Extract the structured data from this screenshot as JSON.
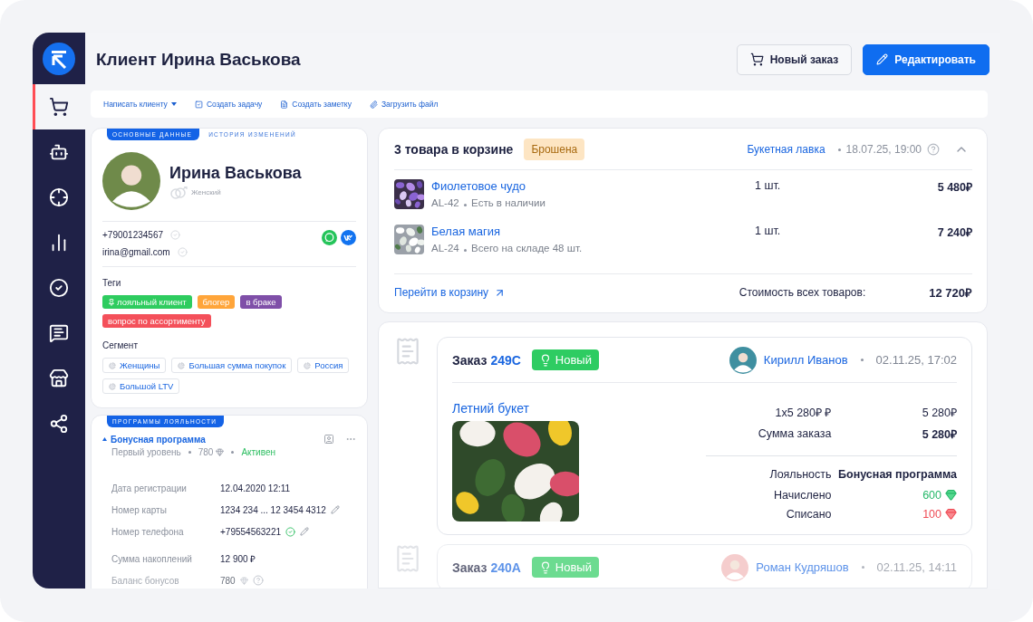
{
  "sidebar": {
    "items": [
      {
        "kind": "cart",
        "selected": true
      },
      {
        "kind": "bot",
        "selected": false
      },
      {
        "kind": "target",
        "selected": false
      },
      {
        "kind": "chart",
        "selected": false
      },
      {
        "kind": "tasks",
        "selected": false
      },
      {
        "kind": "chat",
        "selected": false
      },
      {
        "kind": "store",
        "selected": false
      },
      {
        "kind": "share",
        "selected": false
      }
    ]
  },
  "header": {
    "title": "Клиент Ирина Васькова",
    "buttons": [
      {
        "kind": "secondary",
        "label": "Новый заказ"
      },
      {
        "kind": "primary",
        "label": "Редактировать"
      }
    ]
  },
  "toolbar": [
    {
      "kind": "dropdown",
      "label": "Написать клиенту"
    },
    {
      "kind": "task",
      "label": "Создать задачу"
    },
    {
      "kind": "note",
      "label": "Создать заметку"
    },
    {
      "kind": "file",
      "label": "Загрузить файл"
    }
  ],
  "client": {
    "tabs": [
      {
        "label": "ОСНОВНЫЕ ДАННЫЕ",
        "selected": true
      },
      {
        "label": "ИСТОРИЯ ИЗМЕНЕНИЙ",
        "selected": false
      }
    ],
    "name": "Ирина Васькова",
    "gender": "Женский",
    "contacts": [
      {
        "value": "+79001234567",
        "verified": false
      },
      {
        "value": "irina@gmail.com",
        "verified": false
      }
    ],
    "messengers": [
      {
        "kind": "whatsapp"
      },
      {
        "kind": "vk"
      }
    ],
    "tags_label": "Теги",
    "tags": [
      {
        "label": "лояльный клиент",
        "color": "#2ecc5f",
        "pinned": true
      },
      {
        "label": "блогер",
        "color": "#ffa53a",
        "pinned": false
      },
      {
        "label": "в браке",
        "color": "#7f4fa8",
        "pinned": false
      },
      {
        "label": "вопрос по ассортименту",
        "color": "#f4505a",
        "pinned": false
      }
    ],
    "segments_label": "Сегмент",
    "segments": [
      "Женщины",
      "Большая сумма покупок",
      "Россия",
      "Большой LTV"
    ]
  },
  "loyalty": {
    "section": "ПРОГРАММЫ ЛОЯЛЬНОСТИ",
    "program": {
      "name": "Бонусная программа",
      "expanded": true,
      "level": "Первый уровень",
      "points": "780",
      "status": "Активен",
      "active": true
    },
    "fields": [
      {
        "label": "Дата регистрации",
        "value": "12.04.2020 12:11",
        "kind": "plain",
        "faded": false
      },
      {
        "label": "Номер карты",
        "value": "1234 234 ... 12 3454 4312",
        "kind": "editable",
        "faded": false
      },
      {
        "label": "Номер телефона",
        "value": "+79554563221",
        "kind": "phone",
        "verified": true,
        "faded": false
      },
      {
        "label": "Сумма накоплений",
        "value": "12 900 ₽",
        "kind": "plain",
        "faded": false
      },
      {
        "label": "Баланс бонусов",
        "value": "780",
        "kind": "bonus",
        "faded": true
      }
    ]
  },
  "cart": {
    "title": "3 товара в корзине",
    "status": {
      "label": "Брошена",
      "kind": "abandoned"
    },
    "store": "Букетная лавка",
    "date": "18.07.25, 19:00",
    "expanded": true,
    "items": [
      {
        "name": "Фиолетовое чудо",
        "sku": "AL-42",
        "stock": "Есть в наличии",
        "qty": "1 шт.",
        "price": "5 480₽"
      },
      {
        "name": "Белая магия",
        "sku": "AL-24",
        "stock": "Всего на складе 48 шт.",
        "qty": "1 шт.",
        "price": "7 240₽"
      }
    ],
    "link": "Перейти в корзину",
    "total_label": "Стоимость всех товаров:",
    "total": "12 720₽"
  },
  "orders": [
    {
      "label": "Заказ",
      "number": "249C",
      "status": {
        "label": "Новый",
        "kind": "new"
      },
      "customer": "Кирилл Иванов",
      "date": "02.11.25, 17:02",
      "faded": false,
      "product": "Летний букет",
      "lines": [
        {
          "label": "1x5 280₽ ₽",
          "value": "5 280₽",
          "bold": false
        },
        {
          "label": "Сумма заказа",
          "value": "5 280₽",
          "bold": true
        }
      ],
      "loyalty": {
        "label": "Лояльность",
        "program": "Бонусная программа",
        "accrued_label": "Начислено",
        "accrued": "600",
        "spent_label": "Списано",
        "spent": "100"
      }
    },
    {
      "label": "Заказ",
      "number": "240A",
      "status": {
        "label": "Новый",
        "kind": "new"
      },
      "customer": "Роман Кудряшов",
      "date": "02.11.25, 14:11",
      "faded": true
    }
  ]
}
